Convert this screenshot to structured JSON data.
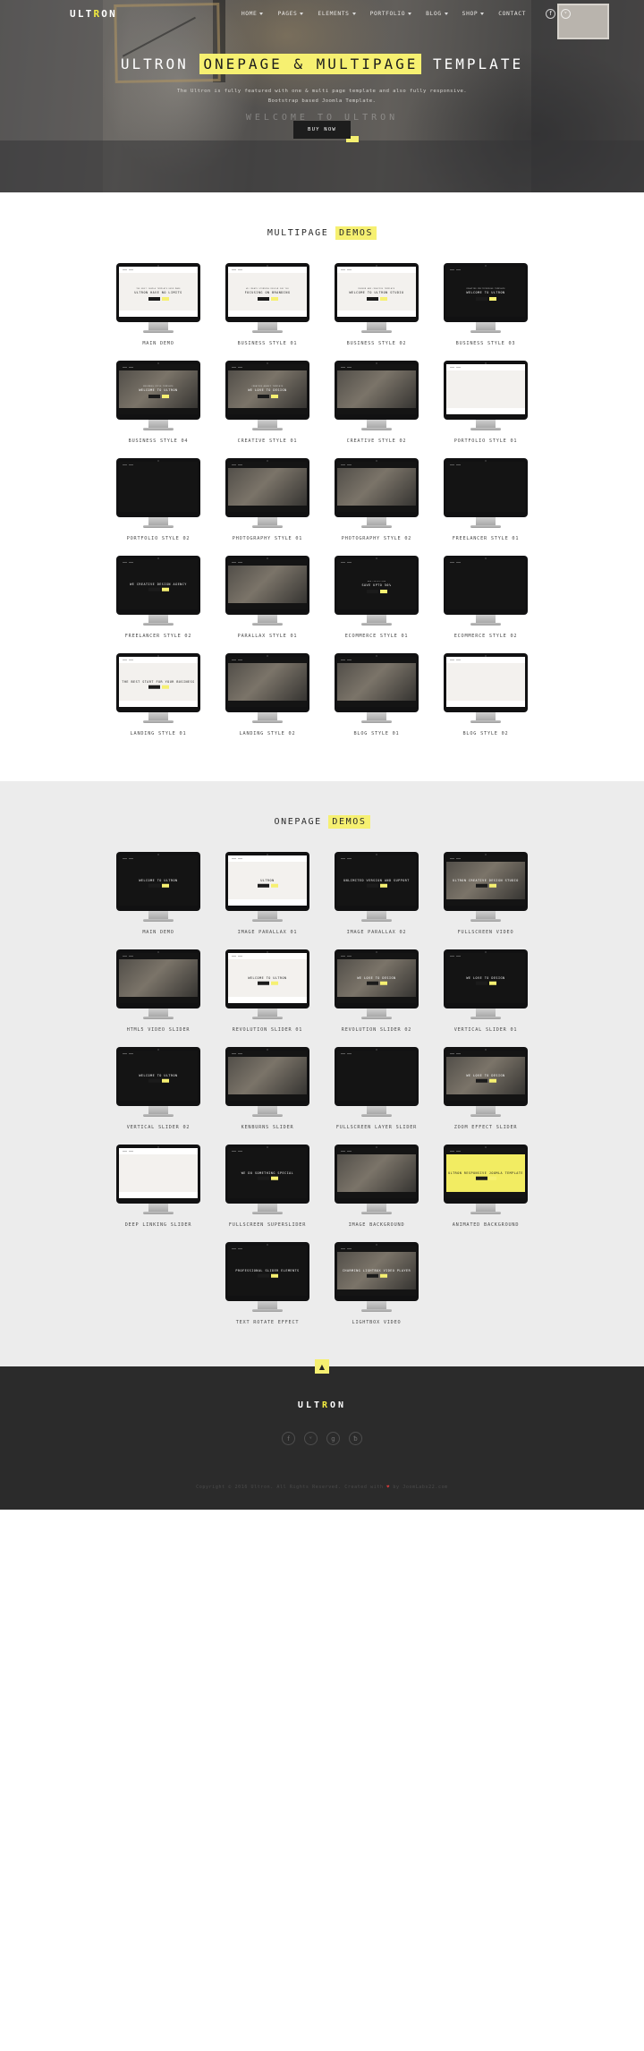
{
  "brand": {
    "name_pre": "ULT",
    "name_hl": "R",
    "name_post": "ON",
    "accent": "#f6f071"
  },
  "nav": {
    "items": [
      {
        "label": "HOME",
        "caret": true
      },
      {
        "label": "PAGES",
        "caret": true
      },
      {
        "label": "ELEMENTS",
        "caret": true
      },
      {
        "label": "PORTFOLIO",
        "caret": true
      },
      {
        "label": "BLOG",
        "caret": true
      },
      {
        "label": "SHOP",
        "caret": true
      },
      {
        "label": "CONTACT",
        "caret": false
      }
    ],
    "social": [
      {
        "name": "facebook-icon",
        "glyph": "f"
      },
      {
        "name": "twitter-icon",
        "glyph": "ᵛ"
      }
    ]
  },
  "hero": {
    "title_pre": "ULTRON",
    "title_mark": "ONEPAGE & MULTIPAGE",
    "title_post": "TEMPLATE",
    "sub_line1": "The Ultron is fully featured with one & multi page template and also fully responsive.",
    "sub_line2": "Bootstrap based Joomla Template.",
    "ghost_text": "WELCOME TO ULTRON",
    "cta_label": "BUY NOW"
  },
  "multipage": {
    "head_pre": "MULTIPAGE",
    "head_mark": "DEMOS",
    "demos": [
      {
        "label": "MAIN DEMO",
        "theme": "light",
        "headline": "ULTRON HAVE NO LIMITS",
        "kicker": "THE BEST JOOMLA TEMPLATE EVER MADE"
      },
      {
        "label": "BUSINESS STYLE 01",
        "theme": "light",
        "headline": "FOCUSING ON BRANDING",
        "kicker": "WE CREATE STUNNING DESIGN FOR YOU"
      },
      {
        "label": "BUSINESS STYLE 02",
        "theme": "light",
        "headline": "WELCOME TO ULTRON STUDIO",
        "kicker": "MODERN AND CREATIVE TEMPLATE"
      },
      {
        "label": "BUSINESS STYLE 03",
        "theme": "dark",
        "headline": "WELCOME TO ULTRON",
        "kicker": "CREATIVE MULTIPURPOSE TEMPLATE"
      },
      {
        "label": "BUSINESS STYLE 04",
        "theme": "photo",
        "headline": "WELCOME TO ULTRON",
        "kicker": "BUSINESS STYLE TEMPLATE"
      },
      {
        "label": "CREATIVE STYLE 01",
        "theme": "photo",
        "headline": "WE LOVE TO DESIGN",
        "kicker": "CREATIVE AGENCY TEMPLATE"
      },
      {
        "label": "CREATIVE STYLE 02",
        "theme": "photo",
        "headline": "",
        "kicker": ""
      },
      {
        "label": "PORTFOLIO STYLE 01",
        "theme": "light",
        "headline": "",
        "kicker": ""
      },
      {
        "label": "PORTFOLIO STYLE 02",
        "theme": "dark",
        "headline": "",
        "kicker": ""
      },
      {
        "label": "PHOTOGRAPHY STYLE 01",
        "theme": "photo",
        "headline": "",
        "kicker": ""
      },
      {
        "label": "PHOTOGRAPHY STYLE 02",
        "theme": "photo",
        "headline": "",
        "kicker": ""
      },
      {
        "label": "FREELANCER STYLE 01",
        "theme": "dark",
        "headline": "",
        "kicker": ""
      },
      {
        "label": "FREELANCER STYLE 02",
        "theme": "dark",
        "headline": "WE CREATIVE DESIGN AGENCY",
        "kicker": ""
      },
      {
        "label": "PARALLAX STYLE 01",
        "theme": "photo",
        "headline": "",
        "kicker": ""
      },
      {
        "label": "ECOMMERCE STYLE 01",
        "theme": "dark",
        "headline": "SAVE UPTO 50%",
        "kicker": "NEW COLLECTION"
      },
      {
        "label": "ECOMMERCE STYLE 02",
        "theme": "dark",
        "headline": "",
        "kicker": ""
      },
      {
        "label": "LANDING STYLE 01",
        "theme": "light",
        "headline": "THE BEST START FOR YOUR BUSINESS",
        "kicker": ""
      },
      {
        "label": "LANDING STYLE 02",
        "theme": "photo",
        "headline": "",
        "kicker": ""
      },
      {
        "label": "BLOG STYLE 01",
        "theme": "photo",
        "headline": "",
        "kicker": ""
      },
      {
        "label": "BLOG STYLE 02",
        "theme": "light",
        "headline": "",
        "kicker": ""
      }
    ]
  },
  "onepage": {
    "head_pre": "ONEPAGE",
    "head_mark": "DEMOS",
    "demos": [
      {
        "label": "MAIN DEMO",
        "theme": "dark",
        "headline": "WELCOME TO ULTRON",
        "kicker": ""
      },
      {
        "label": "IMAGE PARALLAX 01",
        "theme": "light",
        "headline": "ULTRON",
        "kicker": ""
      },
      {
        "label": "IMAGE PARALLAX 02",
        "theme": "dark",
        "headline": "UNLIMITED VERSION AND SUPPORT",
        "kicker": ""
      },
      {
        "label": "FULLSCREEN VIDEO",
        "theme": "photo",
        "headline": "ULTRON CREATIVE DESIGN STUDIO",
        "kicker": ""
      },
      {
        "label": "HTML5 VIDEO SLIDER",
        "theme": "photo",
        "headline": "",
        "kicker": ""
      },
      {
        "label": "REVOLUTION SLIDER 01",
        "theme": "light",
        "headline": "WELCOME TO ULTRON",
        "kicker": ""
      },
      {
        "label": "REVOLUTION SLIDER 02",
        "theme": "photo",
        "headline": "WE LOVE TO DESIGN",
        "kicker": ""
      },
      {
        "label": "VERTICAL SLIDER 01",
        "theme": "dark",
        "headline": "WE LOVE TO DESIGN",
        "kicker": ""
      },
      {
        "label": "VERTICAL SLIDER 02",
        "theme": "dark",
        "headline": "WELCOME TO ULTRON",
        "kicker": ""
      },
      {
        "label": "KENBURNS SLIDER",
        "theme": "photo",
        "headline": "",
        "kicker": ""
      },
      {
        "label": "FULLSCREEN LAYER SLIDER",
        "theme": "dark",
        "headline": "",
        "kicker": ""
      },
      {
        "label": "ZOOM EFFECT SLIDER",
        "theme": "photo",
        "headline": "WE LOVE TO DESIGN",
        "kicker": ""
      },
      {
        "label": "DEEP LINKING SLIDER",
        "theme": "light",
        "headline": "",
        "kicker": ""
      },
      {
        "label": "FULLSCREEN SUPERSLIDER",
        "theme": "dark",
        "headline": "WE DO SOMETHING SPECIAL",
        "kicker": ""
      },
      {
        "label": "IMAGE BACKGROUND",
        "theme": "photo",
        "headline": "",
        "kicker": ""
      },
      {
        "label": "ANIMATED BACKGROUND",
        "theme": "yellow",
        "headline": "ULTRON RESPONSIVE JOOMLA TEMPLATE",
        "kicker": ""
      },
      {
        "label": "TEXT ROTATE EFFECT",
        "theme": "dark",
        "headline": "PROFESSIONAL SLIDER ELEMENTS",
        "kicker": ""
      },
      {
        "label": "LIGHTBOX VIDEO",
        "theme": "photo",
        "headline": "CHARMING LIGHTBOX VIDEO PLAYER",
        "kicker": ""
      }
    ]
  },
  "scrolltop": {
    "glyph": "▲"
  },
  "footer": {
    "logo_pre": "ULT",
    "logo_hl": "R",
    "logo_post": "ON",
    "social": [
      {
        "name": "facebook-icon",
        "glyph": "f"
      },
      {
        "name": "twitter-icon",
        "glyph": "ᵛ"
      },
      {
        "name": "google-plus-icon",
        "glyph": "g"
      },
      {
        "name": "behance-icon",
        "glyph": "ƀ"
      }
    ],
    "copyright_pre": "Copyright © 2016 Ultron. All Rights Reserved. Created with ",
    "copyright_heart": "♥",
    "copyright_post": " by JoomLabs22.com"
  }
}
